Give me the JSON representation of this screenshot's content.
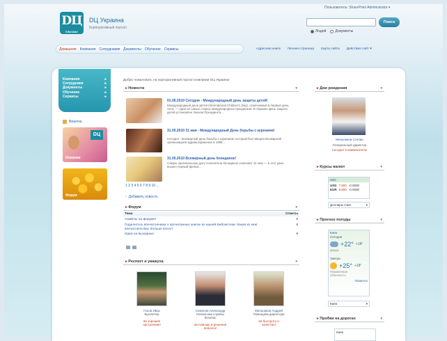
{
  "header": {
    "logo_text": "DЦ",
    "logo_sub": "Ukraine",
    "site_title": "DЦ Украина",
    "site_subtitle": "Корпоративный портал",
    "user_menu": "Пользователь: SharePoint Administrator ▾",
    "search_button": "Поиск",
    "search_scope": [
      "Людей",
      "Документы"
    ]
  },
  "topnav": {
    "items": [
      "Домашняя",
      "Компания",
      "Сотрудники▾",
      "Документы",
      "Обучение",
      "Сервисы"
    ]
  },
  "quicklinks": [
    "Адресная книга",
    "Личная страница",
    "Карта сайта",
    "Действия сайт ▾"
  ],
  "leftnav": {
    "items": [
      "Компания",
      "Сотрудники",
      "Документы",
      "Обучение",
      "Сервисы"
    ]
  },
  "left_tiles": {
    "news_label": "Визитка",
    "tile1": "Новинки",
    "tile2": "Форум"
  },
  "welcome": "Добро пожаловать на корпоративный портал компании DЦ Украина!",
  "news": {
    "title": "Новости",
    "items": [
      {
        "title": "01.06.2010 Сегодня - Международный день защиты детей!",
        "text": "Международный день детей (International Children's Day), отмечаемый в первый день лета, — один из самых старых международных праздников. В Украине День защиты детей установлен Указом Президента..."
      },
      {
        "title": "31.05.2010 31 мая - Международный День борьбы с курением!",
        "text": "Сегодня - Всемирный день борьбы с курением, который был введён Всемирной организацией здравоохранения в 1988..."
      },
      {
        "title": "31.05.2010 Всемирный день блондинок!",
        "text": "Самую оригинальную дату почитатели блондинок отмечают 31 мая — в этот день вышел первый фильм..."
      }
    ],
    "pager": "1 2 3 4 5 6 7 8 9 10 ...",
    "add": "Добавить новость"
  },
  "forum": {
    "title": "Форум",
    "col_topic": "Тема",
    "col_replies": "Ответы",
    "rows": [
      {
        "topic": "Смайлы на форуме!",
        "replies": "5"
      },
      {
        "topic": "Поделитесь впечатлением о прочитанных книгах из нашей Библиотеки. Какая из книг впечатлила Вас больше всего?",
        "replies": "8"
      },
      {
        "topic": "Идеи на выходные",
        "replies": "9"
      }
    ]
  },
  "people": {
    "title": "Респект и уважуха",
    "items": [
      {
        "name": "Голов Ивах",
        "role": "Бухгалтер",
        "link": "За хорошее настроение!"
      },
      {
        "name": "Семенов Александр",
        "role": "Начальник службы безопас",
        "link": "За помощь в решении вопроса!"
      },
      {
        "name": "Мельников Андрей",
        "role": "Помощник директора",
        "link": "За быстроту и качество!"
      }
    ]
  },
  "birthday": {
    "title": "Дни рождения",
    "name": "Мельников Степан",
    "role": "Генеральный директор",
    "note": "Сегодня 3 наименатель!"
  },
  "currency": {
    "title": "Курсы валют",
    "source": "НБУ",
    "rows": [
      {
        "code": "USD",
        "buy": "7.900",
        "change": "-0.0000"
      },
      {
        "code": "EUR",
        "buy": "9.800",
        "change": "-0.0000"
      }
    ],
    "select": "Доллары США"
  },
  "weather": {
    "title": "Прогноз погоды",
    "city": "Киев",
    "today_label": "Сегодня",
    "today_temp": "+22°",
    "today_alt": "+18°",
    "today_desc": "Дождь",
    "tomorrow_label": "Завтра",
    "tomorrow_temp": "+25°",
    "tomorrow_alt": "+18°",
    "tomorrow_desc": "Переменная облачность",
    "source": "Гисметео",
    "select": "Киев"
  },
  "traffic": {
    "title": "Пробки на дорогах",
    "city": "Киев"
  }
}
